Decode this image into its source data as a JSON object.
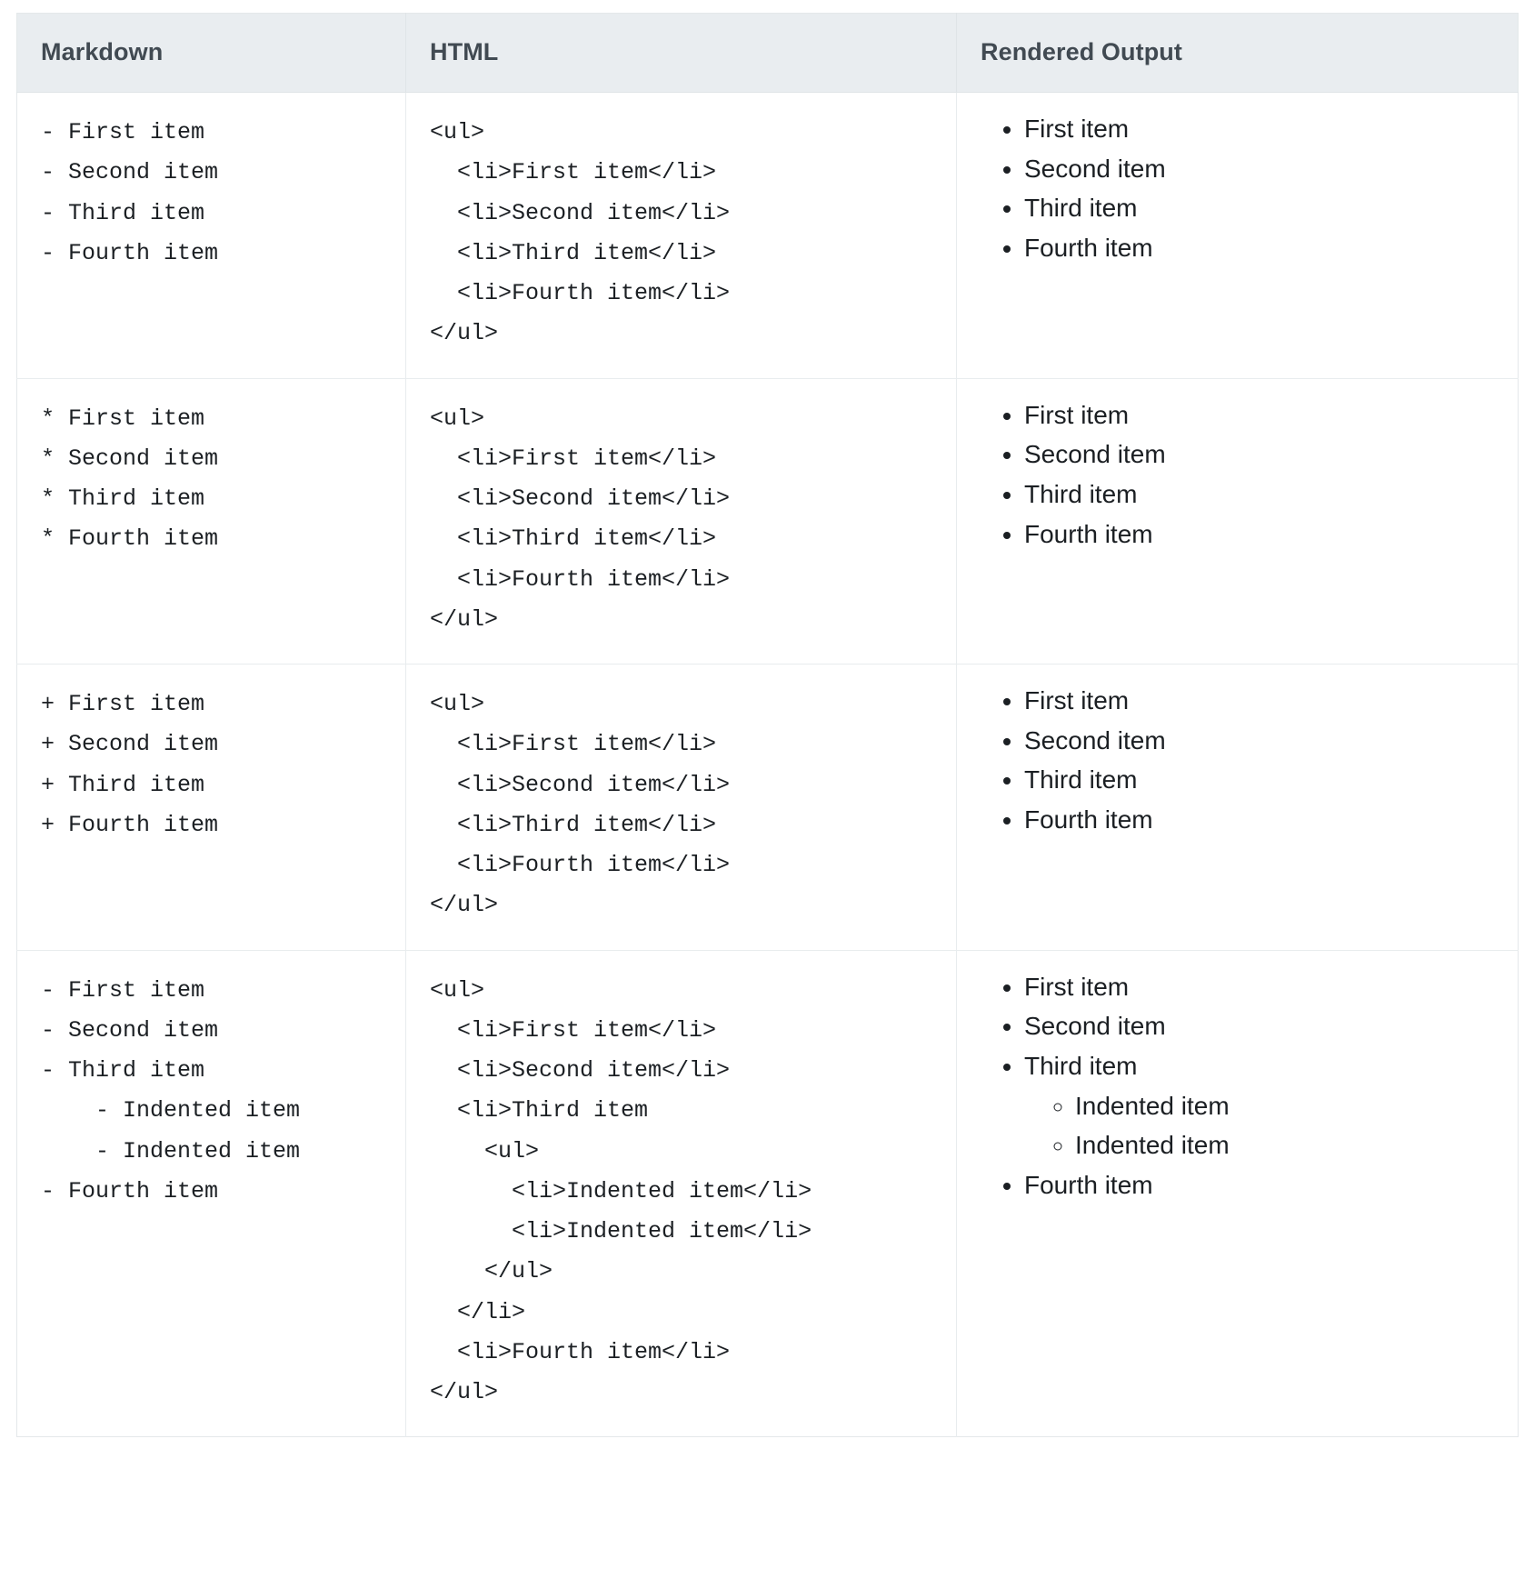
{
  "table": {
    "headers": [
      {
        "label": "Markdown"
      },
      {
        "label": "HTML"
      },
      {
        "label": "Rendered Output"
      }
    ],
    "rows": [
      {
        "markdown": "- First item\n- Second item\n- Third item\n- Fourth item",
        "html": "<ul>\n  <li>First item</li>\n  <li>Second item</li>\n  <li>Third item</li>\n  <li>Fourth item</li>\n</ul>",
        "rendered": {
          "items": [
            {
              "text": "First item",
              "children": []
            },
            {
              "text": "Second item",
              "children": []
            },
            {
              "text": "Third item",
              "children": []
            },
            {
              "text": "Fourth item",
              "children": []
            }
          ]
        }
      },
      {
        "markdown": "* First item\n* Second item\n* Third item\n* Fourth item",
        "html": "<ul>\n  <li>First item</li>\n  <li>Second item</li>\n  <li>Third item</li>\n  <li>Fourth item</li>\n</ul>",
        "rendered": {
          "items": [
            {
              "text": "First item",
              "children": []
            },
            {
              "text": "Second item",
              "children": []
            },
            {
              "text": "Third item",
              "children": []
            },
            {
              "text": "Fourth item",
              "children": []
            }
          ]
        }
      },
      {
        "markdown": "+ First item\n+ Second item\n+ Third item\n+ Fourth item",
        "html": "<ul>\n  <li>First item</li>\n  <li>Second item</li>\n  <li>Third item</li>\n  <li>Fourth item</li>\n</ul>",
        "rendered": {
          "items": [
            {
              "text": "First item",
              "children": []
            },
            {
              "text": "Second item",
              "children": []
            },
            {
              "text": "Third item",
              "children": []
            },
            {
              "text": "Fourth item",
              "children": []
            }
          ]
        }
      },
      {
        "markdown": "- First item\n- Second item\n- Third item\n    - Indented item\n    - Indented item\n- Fourth item",
        "html": "<ul>\n  <li>First item</li>\n  <li>Second item</li>\n  <li>Third item\n    <ul>\n      <li>Indented item</li>\n      <li>Indented item</li>\n    </ul>\n  </li>\n  <li>Fourth item</li>\n</ul>",
        "rendered": {
          "items": [
            {
              "text": "First item",
              "children": []
            },
            {
              "text": "Second item",
              "children": []
            },
            {
              "text": "Third item",
              "children": [
                "Indented item",
                "Indented item"
              ]
            },
            {
              "text": "Fourth item",
              "children": []
            }
          ]
        }
      }
    ]
  },
  "colors": {
    "header_background": "#e9edf0",
    "header_text": "#414a52",
    "body_text": "#1b1f23",
    "border": "#e8ecee",
    "page_background": "#ffffff"
  }
}
